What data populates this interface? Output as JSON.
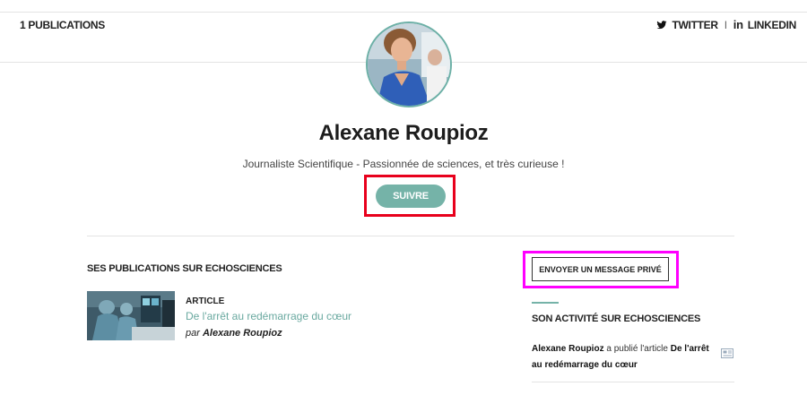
{
  "header": {
    "publications_count": "1 PUBLICATIONS",
    "twitter_label": "TWITTER",
    "separator": "I",
    "linkedin_icon_text": "in",
    "linkedin_label": "LINKEDIN"
  },
  "profile": {
    "name": "Alexane Roupioz",
    "bio": "Journaliste Scientifique - Passionnée de sciences, et très curieuse !",
    "follow_label": "SUIVRE"
  },
  "publications": {
    "section_title": "SES PUBLICATIONS SUR ECHOSCIENCES",
    "items": [
      {
        "type": "ARTICLE",
        "title": "De l'arrêt au redémarrage du cœur",
        "by": "par",
        "author": "Alexane Roupioz"
      }
    ]
  },
  "sidebar": {
    "message_label": "ENVOYER UN MESSAGE PRIVÉ",
    "activity_title": "SON ACTIVITÉ SUR ECHOSCIENCES",
    "activity": {
      "actor": "Alexane Roupioz",
      "verb": " a publié l'article ",
      "object": "De l'arrêt au redémarrage du cœur"
    }
  },
  "colors": {
    "accent": "#75b3a8",
    "link": "#6aa9a0",
    "highlight_follow": "#e8001c",
    "highlight_message": "#ff00ff"
  },
  "icons": [
    "twitter-icon",
    "linkedin-icon",
    "article-icon"
  ]
}
